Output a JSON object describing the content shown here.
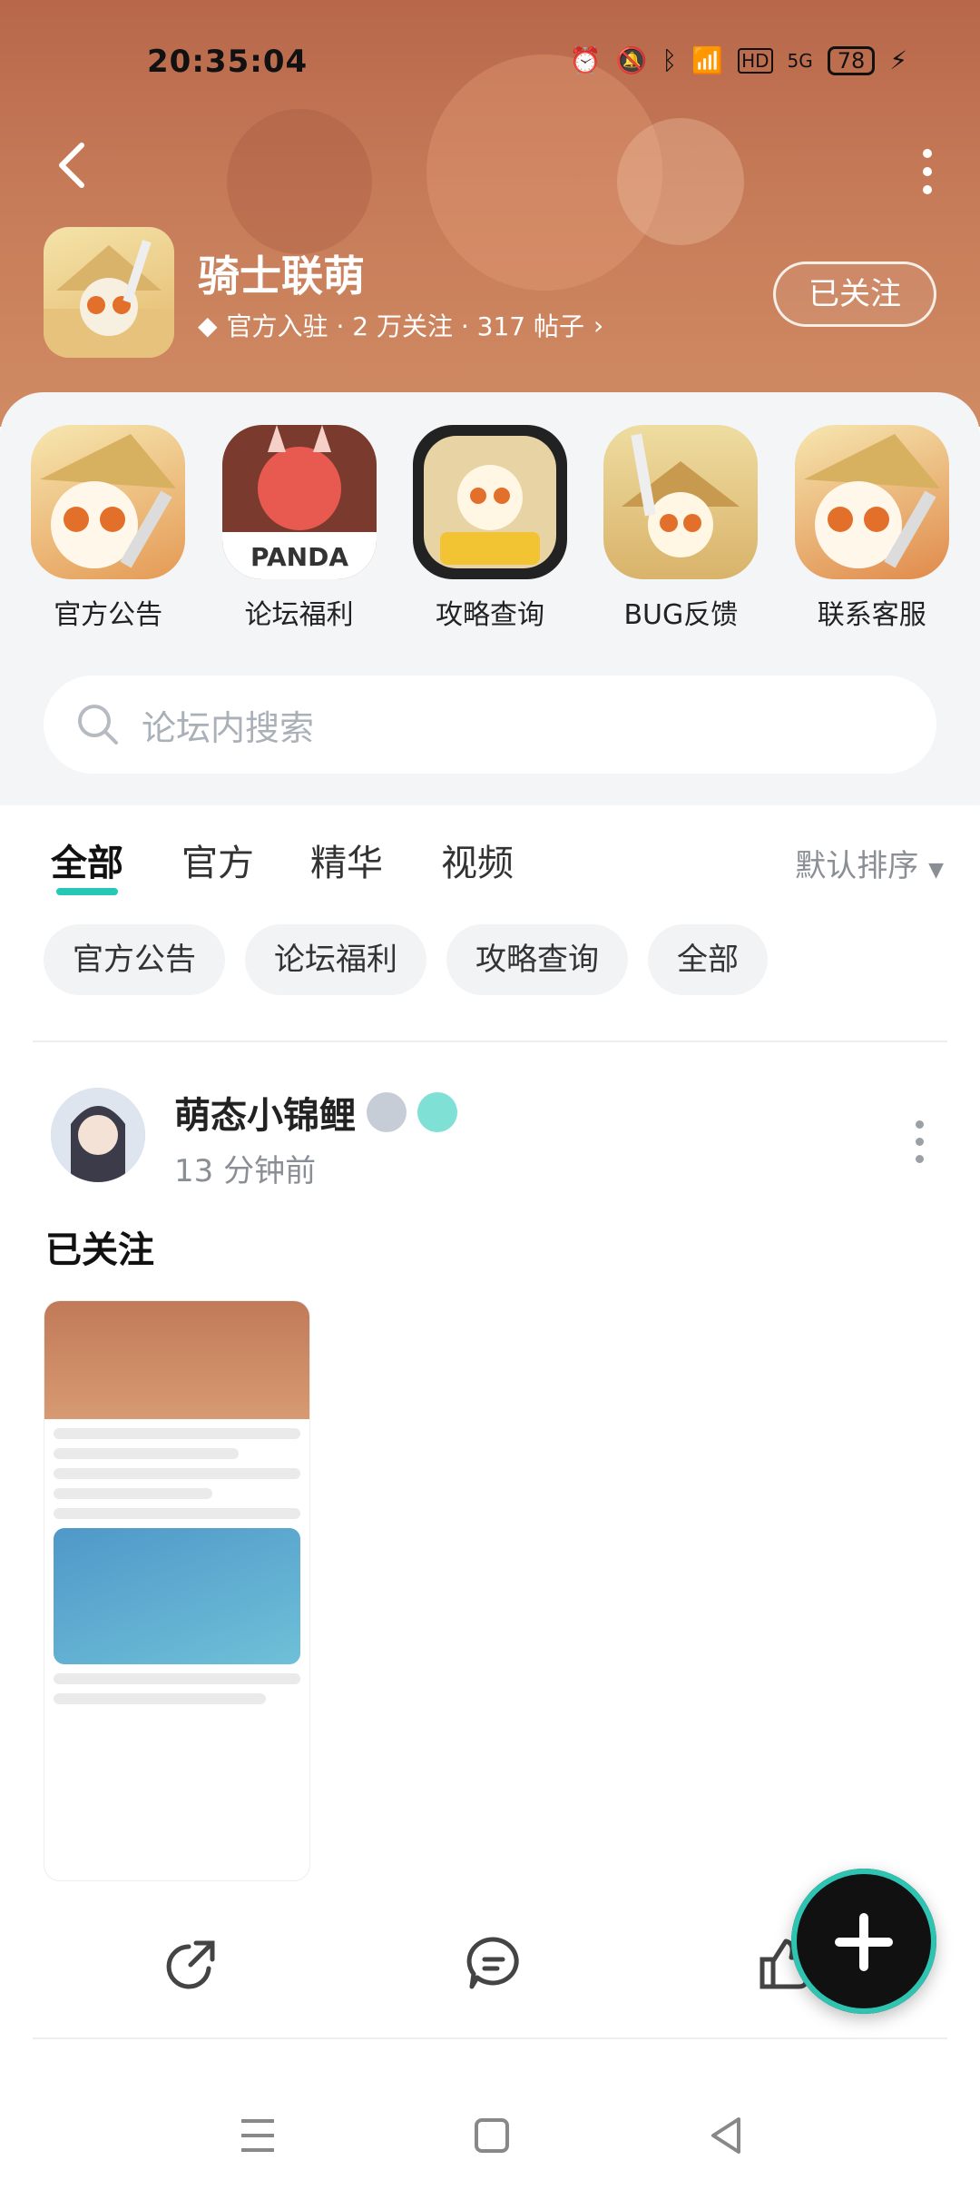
{
  "status_bar": {
    "time": "20:35:04",
    "battery": "78",
    "network": "5G",
    "hd": "HD"
  },
  "forum": {
    "name": "骑士联萌",
    "meta": "官方入驻 · 2 万关注 · 317 帖子",
    "follow_label": "已关注"
  },
  "shortcuts": [
    {
      "label": "官方公告",
      "icon": "panda-announcement"
    },
    {
      "label": "论坛福利",
      "icon": "panda-dragon"
    },
    {
      "label": "攻略查询",
      "icon": "panda-boss"
    },
    {
      "label": "BUG反馈",
      "icon": "panda-sword"
    },
    {
      "label": "联系客服",
      "icon": "panda-support"
    }
  ],
  "search": {
    "placeholder": "论坛内搜索"
  },
  "tabs": [
    {
      "label": "全部",
      "active": true
    },
    {
      "label": "官方",
      "active": false
    },
    {
      "label": "精华",
      "active": false
    },
    {
      "label": "视频",
      "active": false
    }
  ],
  "sort_label": "默认排序",
  "chips": [
    "官方公告",
    "论坛福利",
    "攻略查询",
    "全部"
  ],
  "post": {
    "author": "萌态小锦鲤",
    "time": "13 分钟前",
    "text": "已关注"
  },
  "colors": {
    "accent": "#25c7b5",
    "banner": "#c67b58"
  },
  "icons": [
    "back-icon",
    "more-icon",
    "search-icon",
    "share-icon",
    "comment-icon",
    "like-icon",
    "add-icon",
    "menu-icon",
    "home-icon",
    "back-nav-icon"
  ]
}
